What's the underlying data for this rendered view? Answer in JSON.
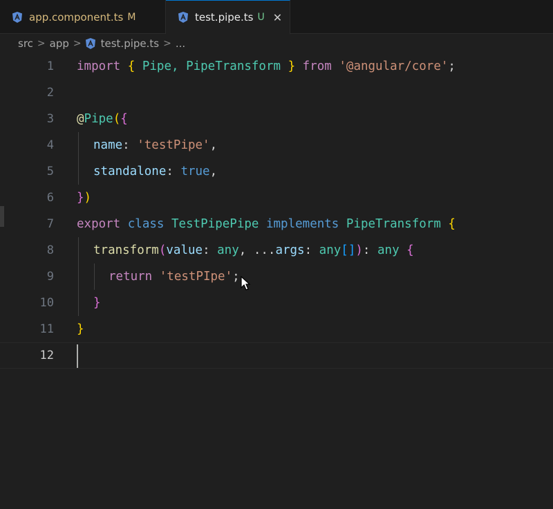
{
  "tabs": [
    {
      "label": "app.component.ts",
      "badge": "M",
      "icon": "angular-icon"
    },
    {
      "label": "test.pipe.ts",
      "badge": "U",
      "icon": "angular-icon",
      "close": "✕"
    }
  ],
  "breadcrumb": {
    "parts": [
      "src",
      "app",
      "test.pipe.ts",
      "..."
    ],
    "separator": ">"
  },
  "editor": {
    "current_line": 12,
    "lines": [
      {
        "n": "1"
      },
      {
        "n": "2"
      },
      {
        "n": "3"
      },
      {
        "n": "4"
      },
      {
        "n": "5"
      },
      {
        "n": "6"
      },
      {
        "n": "7"
      },
      {
        "n": "8"
      },
      {
        "n": "9"
      },
      {
        "n": "10"
      },
      {
        "n": "11"
      },
      {
        "n": "12"
      }
    ],
    "tokens": {
      "l1": [
        "import",
        " ",
        "{",
        " Pipe, PipeTransform ",
        "}",
        " ",
        "from",
        " ",
        "'@angular/core'",
        ";"
      ],
      "l3": [
        "@",
        "Pipe",
        "(",
        "{"
      ],
      "l4": [
        "name",
        ": ",
        "'testPipe'",
        ","
      ],
      "l5": [
        "standalone",
        ": ",
        "true",
        ","
      ],
      "l6": [
        "}",
        ")"
      ],
      "l7": [
        "export",
        " ",
        "class",
        " ",
        "TestPipePipe",
        " ",
        "implements",
        " ",
        "PipeTransform",
        " ",
        "{"
      ],
      "l8": [
        "transform",
        "(",
        "value",
        ": ",
        "any",
        ", ...",
        "args",
        ": ",
        "any",
        "[",
        "]",
        ")",
        ": ",
        "any",
        " ",
        "{"
      ],
      "l9": [
        "return",
        " ",
        "'testPIpe'",
        ";"
      ],
      "l10": [
        "}"
      ],
      "l11": [
        "}"
      ]
    }
  },
  "colors": {
    "accent": "#0078d4",
    "modified": "#d7ba7d",
    "untracked": "#73c991"
  }
}
